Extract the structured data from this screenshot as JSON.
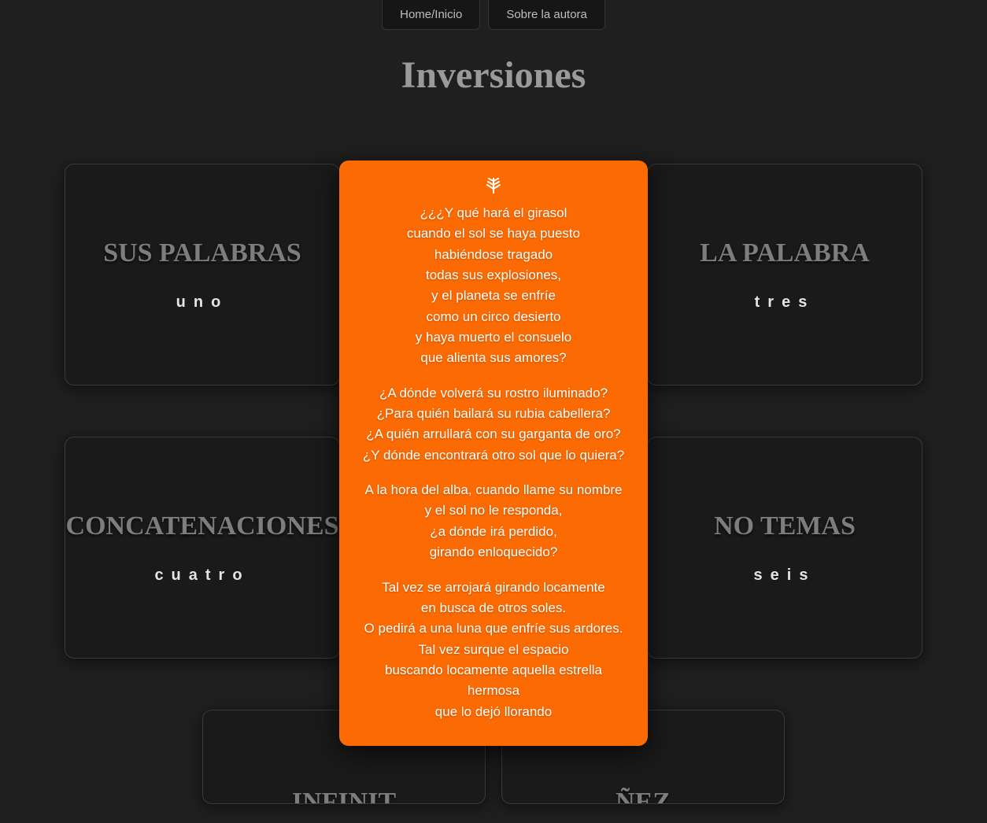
{
  "nav": {
    "home": "Home/Inicio",
    "about": "Sobre la autora"
  },
  "page_title": "Inversiones",
  "cards": [
    {
      "title": "SUS PALABRAS",
      "sub": "uno"
    },
    {
      "title": "",
      "sub": ""
    },
    {
      "title": "LA PALABRA",
      "sub": "tres"
    },
    {
      "title": "CONCATENACIONES",
      "sub": "cuatro"
    },
    {
      "title": "",
      "sub": ""
    },
    {
      "title": "NO TEMAS",
      "sub": "seis"
    }
  ],
  "partial_cards": [
    {
      "title": "INFINIT"
    },
    {
      "title": "ÑEZ"
    }
  ],
  "poem": {
    "stanzas": [
      [
        "¿¿¿Y qué hará el girasol",
        "cuando el sol se haya puesto",
        "habiéndose tragado",
        "todas sus explosiones,",
        "y el planeta se enfríe",
        "como un circo desierto",
        "y haya muerto el consuelo",
        "que alienta sus amores?"
      ],
      [
        "¿A dónde volverá su rostro iluminado?",
        "¿Para quién bailará su rubia cabellera?",
        "¿A quién arrullará con su garganta de oro?",
        "¿Y dónde encontrará otro sol que lo quiera?"
      ],
      [
        "A la hora del alba, cuando llame su nombre",
        "y el sol no le responda,",
        "¿a dónde irá perdido,",
        "girando enloquecido?"
      ],
      [
        "Tal vez se arrojará girando locamente",
        "en busca de otros soles.",
        "O pedirá a una luna que enfríe sus ardores.",
        "Tal vez surque el espacio",
        "buscando locamente aquella estrella hermosa",
        "que lo dejó llorando"
      ]
    ]
  }
}
